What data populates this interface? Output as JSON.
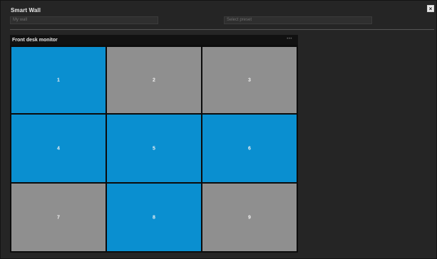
{
  "window": {
    "title": "Smart Wall",
    "close_label": "×"
  },
  "selectors": {
    "wall": "My wall",
    "preset": "Select preset"
  },
  "monitor": {
    "name": "Front desk monitor",
    "menu_label": "•••"
  },
  "tiles": [
    {
      "label": "1",
      "state": "active",
      "color": "#0a8fd0"
    },
    {
      "label": "2",
      "state": "inactive",
      "color": "#8f8f8f"
    },
    {
      "label": "3",
      "state": "inactive",
      "color": "#8f8f8f"
    },
    {
      "label": "4",
      "state": "active",
      "color": "#0a8fd0"
    },
    {
      "label": "5",
      "state": "active",
      "color": "#0a8fd0"
    },
    {
      "label": "6",
      "state": "active",
      "color": "#0a8fd0"
    },
    {
      "label": "7",
      "state": "inactive",
      "color": "#8f8f8f"
    },
    {
      "label": "8",
      "state": "active",
      "color": "#0a8fd0"
    },
    {
      "label": "9",
      "state": "inactive",
      "color": "#8f8f8f"
    }
  ]
}
